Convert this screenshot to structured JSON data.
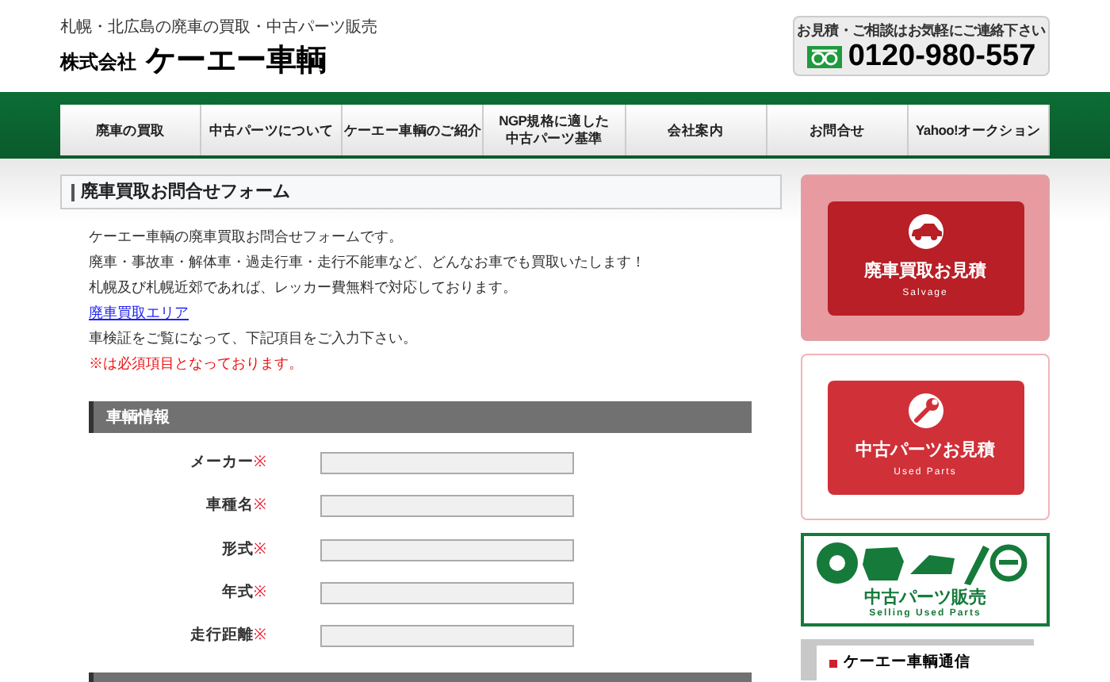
{
  "header": {
    "tagline": "札幌・北広島の廃車の買取・中古パーツ販売",
    "company_prefix": "株式会社",
    "company_name": "ケーエー車輌",
    "contact_label": "お見積・ご相談はお気軽にご連絡下さい",
    "phone": "0120-980-557"
  },
  "nav": [
    {
      "label": "廃車の買取"
    },
    {
      "label": "中古パーツについて"
    },
    {
      "label": "ケーエー車輌のご紹介"
    },
    {
      "lines": [
        "NGP規格に適した",
        "中古パーツ基準"
      ]
    },
    {
      "label": "会社案内"
    },
    {
      "label": "お問合せ"
    },
    {
      "label": "Yahoo!オークション"
    }
  ],
  "form": {
    "title": "廃車買取お問合せフォーム",
    "intro": [
      {
        "kind": "text",
        "text": "ケーエー車輌の廃車買取お問合せフォームです。"
      },
      {
        "kind": "text",
        "text": "廃車・事故車・解体車・過走行車・走行不能車など、どんなお車でも買取いたします！"
      },
      {
        "kind": "text",
        "text": "札幌及び札幌近郊であれば、レッカー費無料で対応しております。"
      },
      {
        "kind": "link",
        "text": "廃車買取エリア"
      },
      {
        "kind": "text",
        "text": "車検証をご覧になって、下記項目をご入力下さい。"
      },
      {
        "kind": "note",
        "text": "※は必須項目となっております。"
      }
    ],
    "section": "車輌情報",
    "fields": [
      {
        "label": "メーカー",
        "required": true
      },
      {
        "label": "車種名",
        "required": true
      },
      {
        "label": "形式",
        "required": true
      },
      {
        "label": "年式",
        "required": true
      },
      {
        "label": "走行距離",
        "required": true
      }
    ],
    "required_mark": "※"
  },
  "sidebar": {
    "banners": [
      {
        "kind": "salvage",
        "title": "廃車買取お見積",
        "subtitle": "Salvage"
      },
      {
        "kind": "parts",
        "title": "中古パーツお見積",
        "subtitle": "Used Parts"
      },
      {
        "kind": "selling",
        "title": "中古パーツ販売",
        "subtitle": "Selling Used Parts"
      }
    ],
    "news_title": "ケーエー車輌通信"
  }
}
